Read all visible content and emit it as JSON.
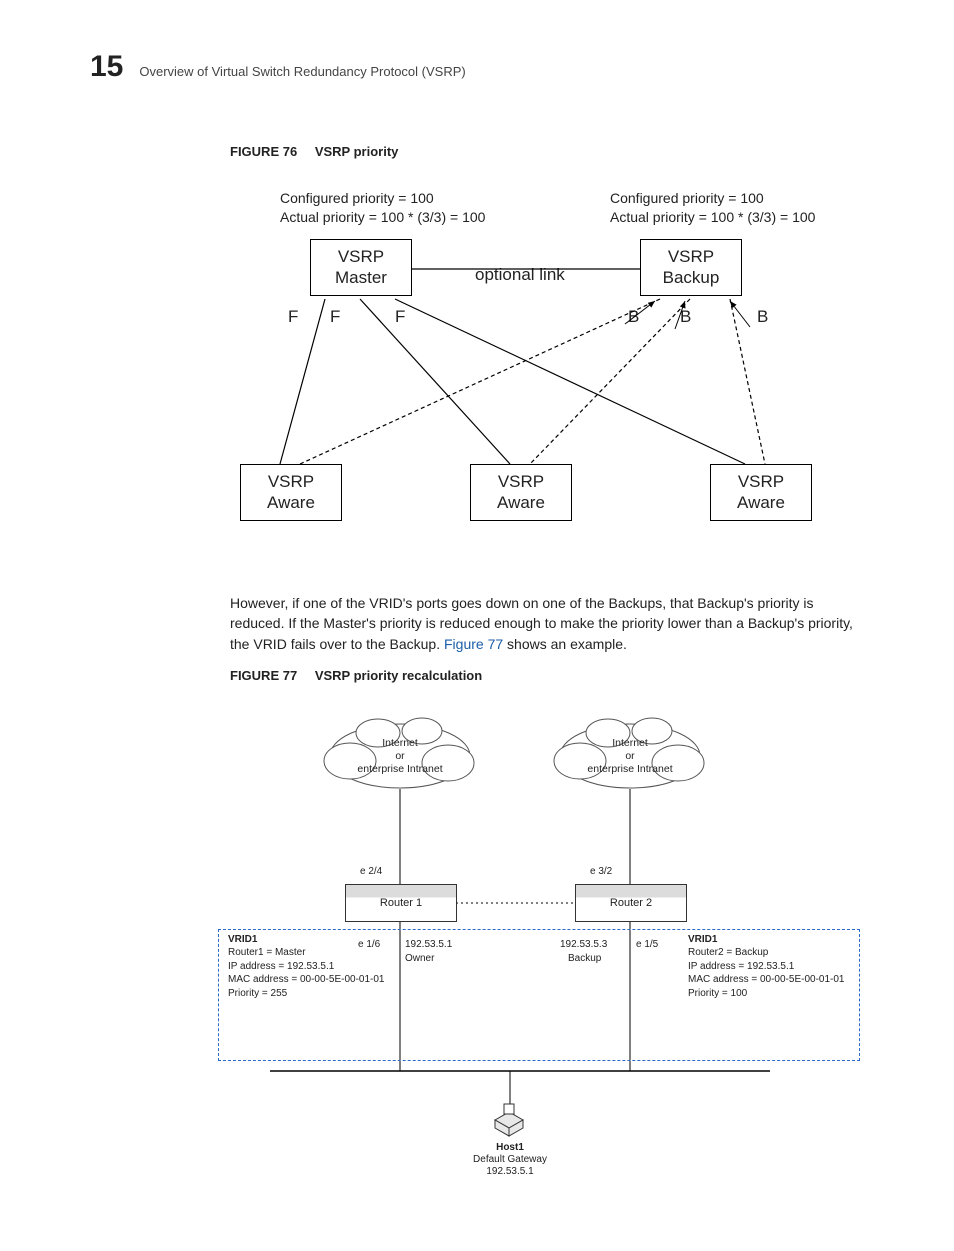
{
  "header": {
    "chapter_number": "15",
    "title": "Overview of Virtual Switch Redundancy Protocol (VSRP)"
  },
  "figure76": {
    "caption_prefix": "FIGURE 76",
    "caption_title": "VSRP priority",
    "left_ann_l1": "Configured priority = 100",
    "left_ann_l2": "Actual priority = 100 * (3/3) = 100",
    "right_ann_l1": "Configured priority = 100",
    "right_ann_l2": "Actual priority = 100 * (3/3) = 100",
    "master_l1": "VSRP",
    "master_l2": "Master",
    "backup_l1": "VSRP",
    "backup_l2": "Backup",
    "optional": "optional link",
    "F": "F",
    "B": "B",
    "aware_l1": "VSRP",
    "aware_l2": "Aware"
  },
  "para": {
    "t1": "However, if one of the VRID's ports goes down on one of the Backups, that Backup's priority is reduced. If the Master's priority is reduced enough to make the priority lower than a Backup's priority, the VRID fails over to the Backup. ",
    "link": "Figure 77",
    "t2": " shows an example."
  },
  "figure77": {
    "caption_prefix": "FIGURE 77",
    "caption_title": "VSRP priority recalculation",
    "cloud_l1": "Internet",
    "cloud_l2": "or",
    "cloud_l3": "enterprise Intranet",
    "e24": "e 2/4",
    "e32": "e 3/2",
    "router1": "Router 1",
    "router2": "Router 2",
    "e16": "e 1/6",
    "e15": "e 1/5",
    "owner_ip": "192.53.5.1",
    "owner_lbl": "Owner",
    "backup_ip": "192.53.5.3",
    "backup_lbl": "Backup",
    "vrid1_head": "VRID1",
    "left_r": "Router1 = Master",
    "left_ip": "IP address = 192.53.5.1",
    "left_mac": "MAC address = 00-00-5E-00-01-01",
    "left_pri": "Priority = 255",
    "right_r": "Router2 = Backup",
    "right_ip": "IP address = 192.53.5.1",
    "right_mac": "MAC address = 00-00-5E-00-01-01",
    "right_pri": "Priority = 100",
    "host": "Host1",
    "host_gw": "Default Gateway",
    "host_ip": "192.53.5.1"
  }
}
